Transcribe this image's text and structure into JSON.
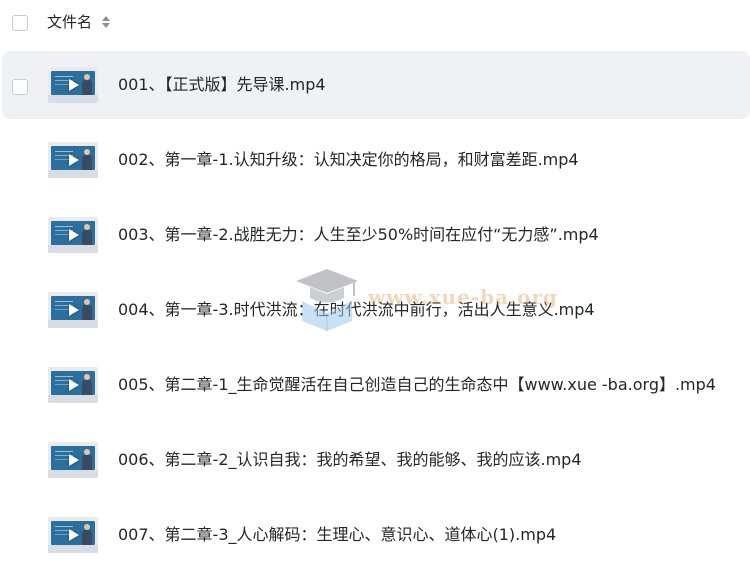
{
  "header": {
    "column_label": "文件名",
    "sort_icon": "sort-updown-icon"
  },
  "files": [
    {
      "name": "001、【正式版】先导课.mp4",
      "selected": true,
      "icon": "video-thumbnail"
    },
    {
      "name": "002、第一章-1.认知升级：认知决定你的格局，和财富差距.mp4",
      "selected": false,
      "icon": "video-thumbnail"
    },
    {
      "name": "003、第一章-2.战胜无力：人生至少50%时间在应付“无力感”.mp4",
      "selected": false,
      "icon": "video-thumbnail"
    },
    {
      "name": "004、第一章-3.时代洪流：在时代洪流中前行，活出人生意义.mp4",
      "selected": false,
      "icon": "video-thumbnail"
    },
    {
      "name": "005、第二章-1_生命觉醒活在自己创造自己的生命态中【www.xue -ba.org】.mp4",
      "selected": false,
      "icon": "video-thumbnail"
    },
    {
      "name": "006、第二章-2_认识自我：我的希望、我的能够、我的应该.mp4",
      "selected": false,
      "icon": "video-thumbnail"
    },
    {
      "name": "007、第二章-3_人心解码：生理心、意识心、道体心(1).mp4",
      "selected": false,
      "icon": "video-thumbnail"
    }
  ],
  "watermark": {
    "text": "www.xue-ba.org",
    "icon": "graduation-cap-icon"
  },
  "colors": {
    "selected_row_bg": "#f0f1f4",
    "text": "#25262b",
    "checkbox_border": "#c9cbd1"
  }
}
